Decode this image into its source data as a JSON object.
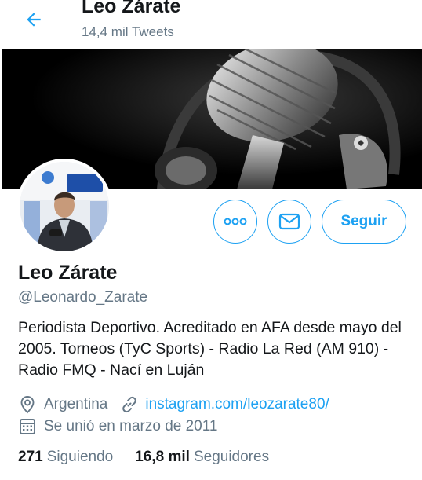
{
  "header": {
    "title": "Leo Zárate",
    "tweet_count": "14,4 mil Tweets"
  },
  "profile": {
    "name": "Leo Zárate",
    "handle": "@Leonardo_Zarate",
    "bio": "Periodista Deportivo. Acreditado en AFA desde mayo del 2005. Torneos (TyC Sports) - Radio La Red (AM 910) - Radio FMQ - Nací en Luján",
    "location": "Argentina",
    "website": "instagram.com/leozarate80/",
    "joined": "Se unió en marzo de 2011"
  },
  "actions": {
    "follow_label": "Seguir"
  },
  "stats": {
    "following_count": "271",
    "following_label": "Siguiendo",
    "followers_count": "16,8 mil",
    "followers_label": "Seguidores"
  },
  "colors": {
    "accent": "#1da1f2",
    "text_primary": "#14171a",
    "text_secondary": "#657786"
  },
  "icons": [
    "back-arrow-icon",
    "more-icon",
    "mail-icon",
    "location-pin-icon",
    "link-icon",
    "calendar-icon"
  ]
}
